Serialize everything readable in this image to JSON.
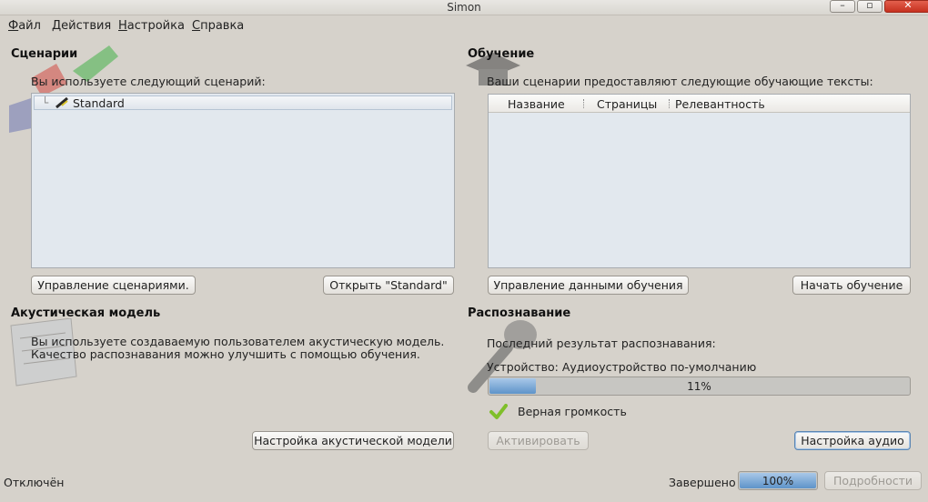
{
  "window": {
    "title": "Simon"
  },
  "menu": [
    {
      "label": "Файл",
      "u": "Ф",
      "rest": "айл"
    },
    {
      "label": "Действия",
      "u": "Д",
      "rest": "ействия"
    },
    {
      "label": "Настройка",
      "u": "Н",
      "rest": "астройка"
    },
    {
      "label": "Справка",
      "u": "С",
      "rest": "правка"
    }
  ],
  "scenarios": {
    "title": "Сценарии",
    "description": "Вы используете следующий сценарий:",
    "items": [
      "Standard"
    ],
    "manage_button": "Управление сценариями.",
    "open_button": "Открыть \"Standard\""
  },
  "training": {
    "title": "Обучение",
    "description": "Ваши сценарии предоставляют следующие обучающие тексты:",
    "columns": [
      "Название",
      "Страницы",
      "Релевантность"
    ],
    "manage_button": "Управление данными обучения",
    "start_button": "Начать обучение"
  },
  "acoustic": {
    "title": "Акустическая модель",
    "line1": "Вы используете создаваемую пользователем акустическую модель.",
    "line2": "Качество распознавания можно улучшить с помощью обучения.",
    "settings_button": "Настройка акустической модели"
  },
  "recognition": {
    "title": "Распознавание",
    "last_result_label": "Последний результат распознавания:",
    "device_label": "Устройство: Аудиоустройство по-умолчанию",
    "level_percent": 11,
    "level_text": "11%",
    "volume_status": "Верная громкость",
    "activate_button": "Активировать",
    "audio_settings_button": "Настройка аудио"
  },
  "status": {
    "connection": "Отключён",
    "progress_label": "Завершено",
    "progress_percent": 100,
    "progress_text": "100%",
    "details_button": "Подробности"
  },
  "colors": {
    "accent": "#5e93c9",
    "check": "#7fbf2a"
  }
}
